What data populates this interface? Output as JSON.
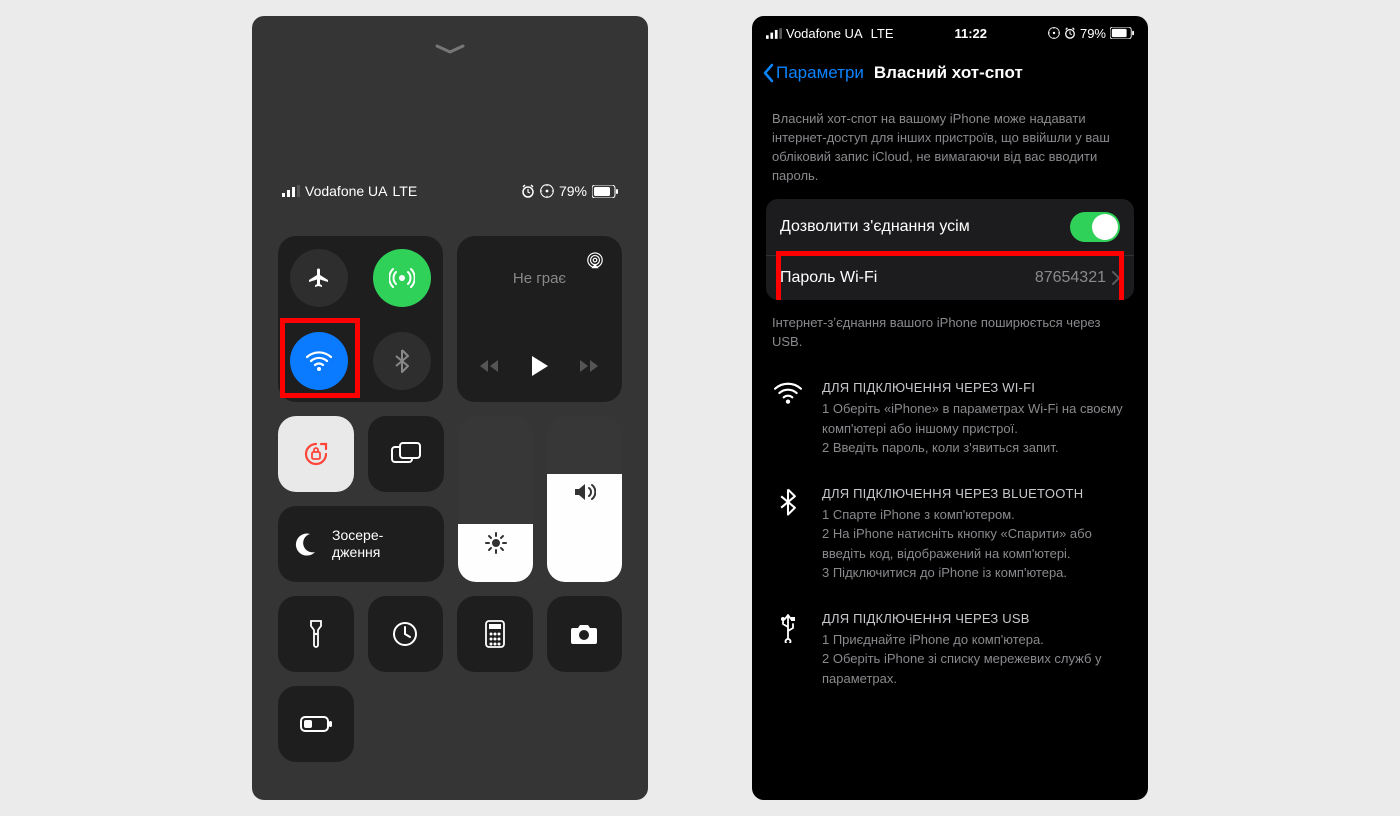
{
  "cc": {
    "carrier": "Vodafone UA",
    "net": "LTE",
    "battery": "79%",
    "now_playing": "Не грає",
    "focus_label": "Зосере-\nдження",
    "brightness_pct": 35,
    "volume_pct": 65
  },
  "hs": {
    "statusbar": {
      "carrier": "Vodafone UA",
      "net": "LTE",
      "time": "11:22",
      "battery": "79%"
    },
    "nav": {
      "back": "Параметри",
      "title": "Власний хот-спот"
    },
    "desc": "Власний хот-спот на вашому iPhone може надавати інтернет-доступ для інших пристроїв, що ввійшли у ваш обліковий запис iCloud, не вимагаючи від вас вводити пароль.",
    "allow_label": "Дозволити з'єднання усім",
    "pwd_label": "Пароль Wi-Fi",
    "pwd_value": "87654321",
    "usb_note": "Інтернет-зʼєднання вашого iPhone поширюється через USB.",
    "wifi": {
      "hdr": "ДЛЯ ПІДКЛЮЧЕННЯ ЧЕРЕЗ WI-FI",
      "s1": "1 Оберіть «iPhone» в параметрах Wi-Fi на своєму комп'ютері або іншому пристрої.",
      "s2": "2 Введіть пароль, коли з'явиться запит."
    },
    "bt": {
      "hdr": "ДЛЯ ПІДКЛЮЧЕННЯ ЧЕРЕЗ BLUETOOTH",
      "s1": "1 Спарте iPhone з комп'ютером.",
      "s2": "2 На iPhone натисніть кнопку «Спарити» або введіть код, відображений на комп'ютері.",
      "s3": "3 Підключитися до iPhone із комп'ютера."
    },
    "usb": {
      "hdr": "ДЛЯ ПІДКЛЮЧЕННЯ ЧЕРЕЗ USB",
      "s1": "1 Приєднайте iPhone до комп'ютера.",
      "s2": "2 Оберіть iPhone зі списку мережевих служб у параметрах."
    }
  }
}
